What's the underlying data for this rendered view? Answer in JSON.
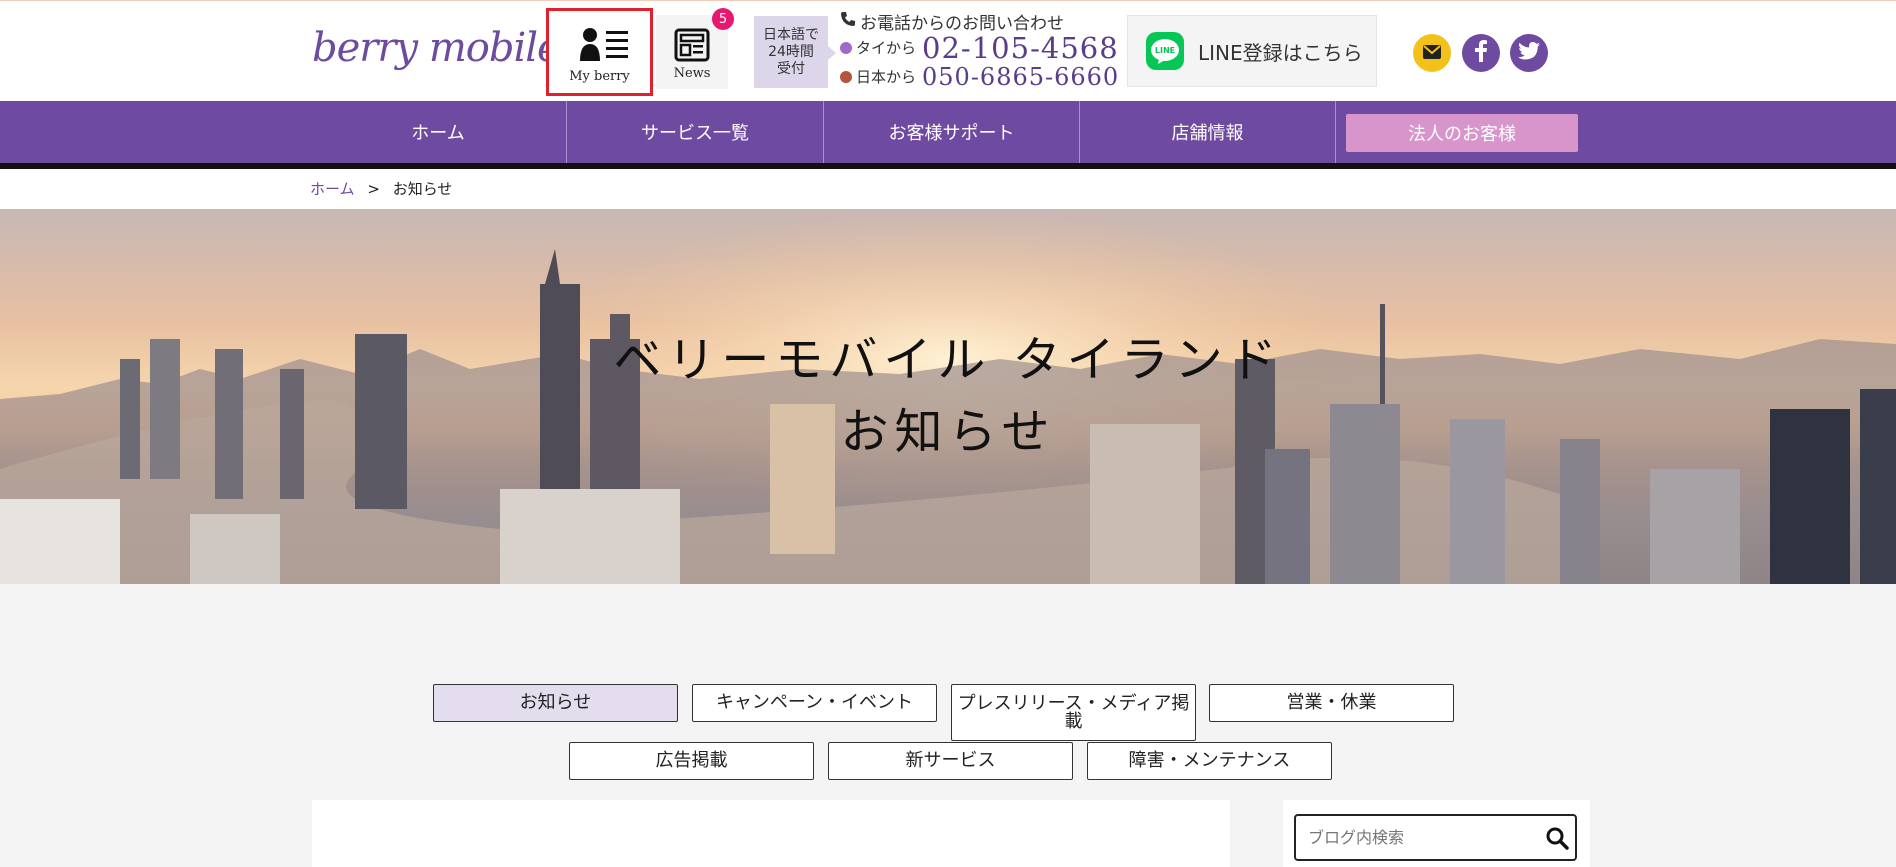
{
  "header": {
    "logo": "berry mobile",
    "my_berry_label": "My berry",
    "news_label": "News",
    "news_badge": "5",
    "jp_support": [
      "日本語で",
      "24時間",
      "受付"
    ],
    "contact_title": "お電話からのお問い合わせ",
    "thai_label": "タイから",
    "thai_number": "02-105-4568",
    "japan_label": "日本から",
    "japan_number": "050-6865-6660",
    "line_label": "LINE登録はこちら",
    "line_icon_text": "LINE",
    "colors": {
      "brand": "#6f4aa1",
      "thai_dot": "#a06bc8",
      "japan_dot": "#b4543c"
    }
  },
  "nav": {
    "items": [
      "ホーム",
      "サービス一覧",
      "お客様サポート",
      "店舗情報"
    ],
    "corporate": "法人のお客様"
  },
  "breadcrumb": {
    "home": "ホーム",
    "sep": ">",
    "current": "お知らせ"
  },
  "hero": {
    "line1": "ベリーモバイル タイランド",
    "line2": "お知らせ"
  },
  "tabs": {
    "row1": [
      "お知らせ",
      "キャンペーン・イベント",
      "プレスリリース・メディア掲載",
      "営業・休業"
    ],
    "row2": [
      "広告掲載",
      "新サービス",
      "障害・メンテナンス"
    ]
  },
  "sidebar": {
    "search_placeholder": "ブログ内検索"
  },
  "icons": [
    "user-list-icon",
    "newspaper-icon",
    "phone-icon",
    "line-icon",
    "mail-icon",
    "facebook-icon",
    "twitter-icon",
    "search-icon"
  ]
}
